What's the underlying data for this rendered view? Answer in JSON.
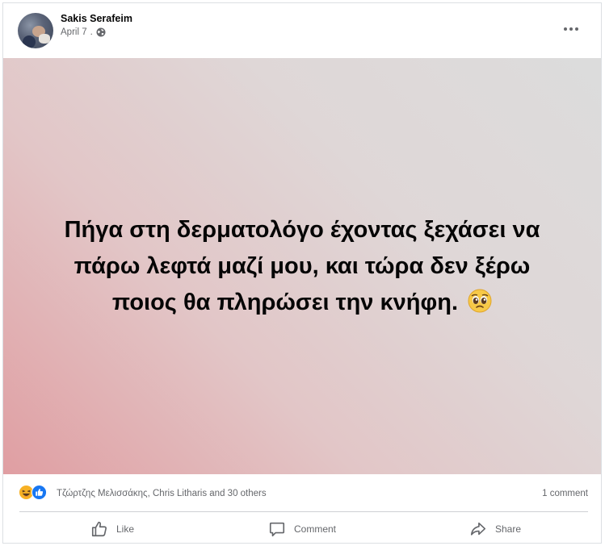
{
  "post": {
    "author": "Sakis Serafeim",
    "date": "April 7",
    "separator": ".",
    "text_line1": "Πήγα στη δερματολόγο έχοντας ξεχάσει να",
    "text_line2": "πάρω λεφτά μαζί μου, και τώρα δεν ξέρω",
    "text_line3": "ποιος θα πληρώσει την κνήφη.",
    "text_emoji_icon": "pleading-face-icon",
    "background_colors": [
      "#dcdcdc",
      "#e09ea2"
    ]
  },
  "reactions": {
    "icons": [
      "haha-icon",
      "like-icon"
    ],
    "names": "Τζώρτζης Μελισσάκης, Chris Litharis and 30 others",
    "comments_count": "1 comment"
  },
  "actions": {
    "like_label": "Like",
    "comment_label": "Comment",
    "share_label": "Share"
  },
  "colors": {
    "secondary_text": "#65676b",
    "like_blue": "#1877f2",
    "haha_yellow": "#f7b125"
  }
}
